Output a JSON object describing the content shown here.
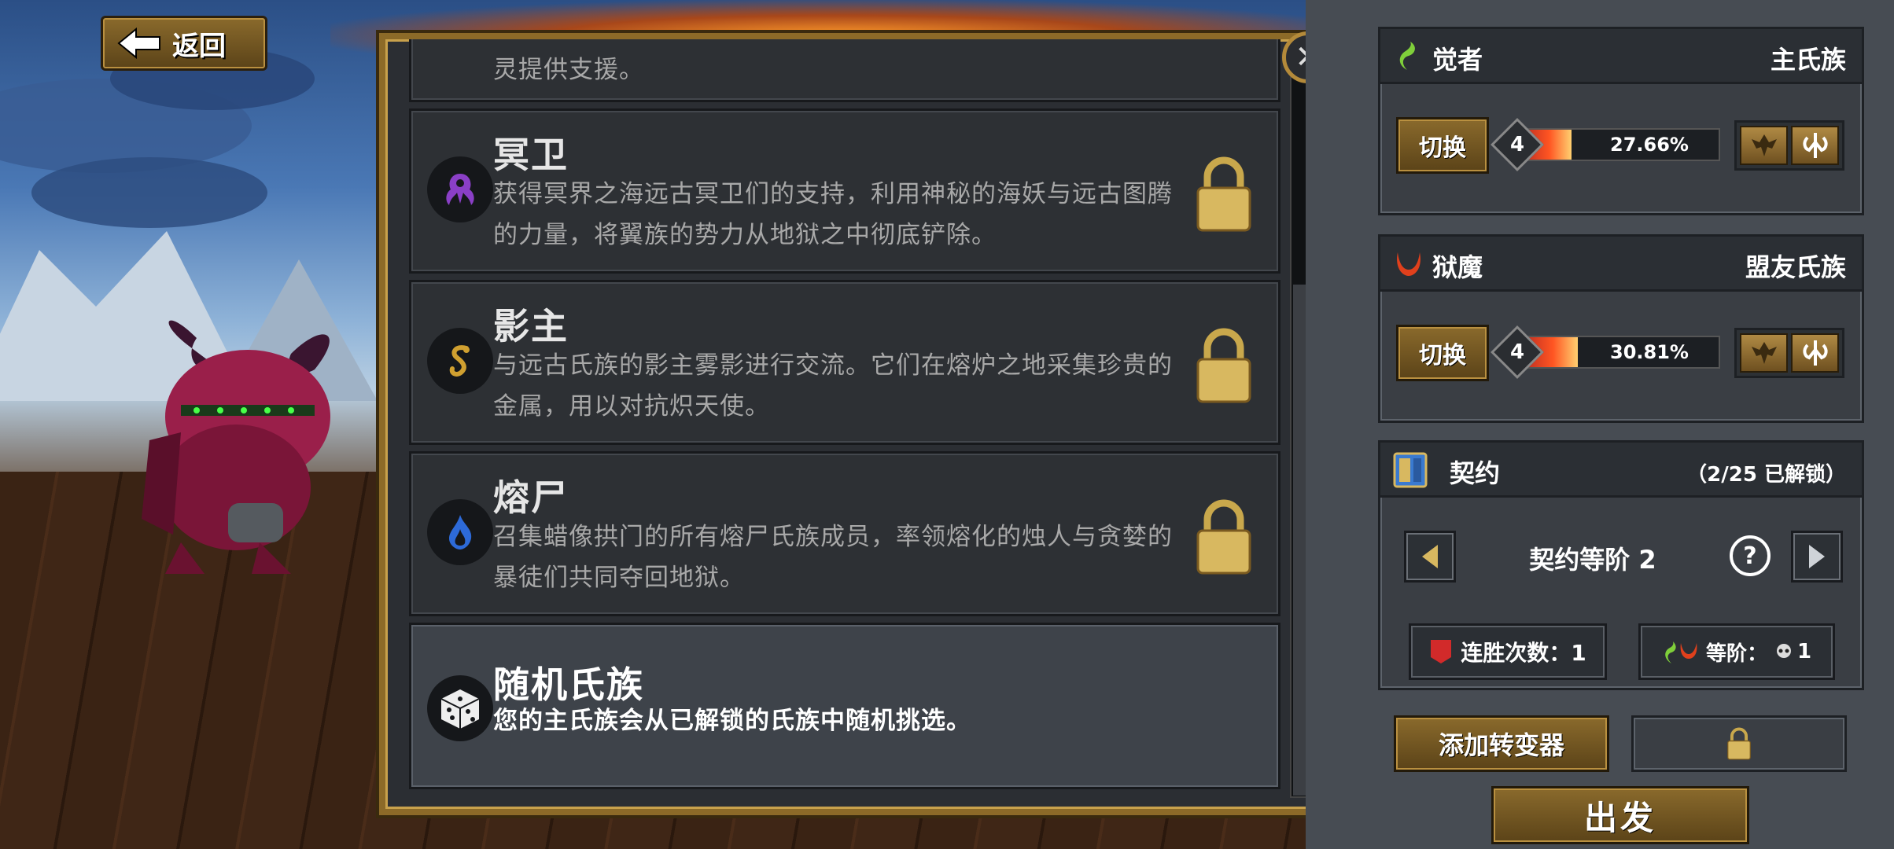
{
  "nav": {
    "back_label": "返回"
  },
  "clans": [
    {
      "name": "",
      "desc": "灵提供支援。",
      "locked": false
    },
    {
      "name": "冥卫",
      "desc": "获得冥界之海远古冥卫们的支持，利用神秘的海妖与远古图腾的力量，将翼族的势力从地狱之中彻底铲除。",
      "icon": "tentacle-icon",
      "locked": true
    },
    {
      "name": "影主",
      "desc": "与远古氏族的影主雾影进行交流。它们在熔炉之地采集珍贵的金属，用以对抗炽天使。",
      "icon": "spiral-icon",
      "locked": true
    },
    {
      "name": "熔尸",
      "desc": "召集蜡像拱门的所有熔尸氏族成员，率领熔化的烛人与贪婪的暴徒们共同夺回地狱。",
      "icon": "flame-icon",
      "locked": true
    },
    {
      "name": "随机氏族",
      "desc": "您的主氏族会从已解锁的氏族中随机挑选。",
      "icon": "dice-icon",
      "locked": false
    }
  ],
  "primary_clan": {
    "name": "觉者",
    "role": "主氏族",
    "switch_label": "切换",
    "level": "4",
    "progress_text": "27.66%",
    "progress": 0.2766,
    "color": "#7fcf3a"
  },
  "allied_clan": {
    "name": "狱魔",
    "role": "盟友氏族",
    "switch_label": "切换",
    "level": "4",
    "progress_text": "30.81%",
    "progress": 0.3081,
    "color": "#e0401c"
  },
  "covenant": {
    "title": "契约",
    "unlocked": "（2/25 已解锁）",
    "rank_label": "契约等阶 2",
    "win_streak": "连胜次数：1",
    "grade": "等阶：",
    "grade_value": "1"
  },
  "actions": {
    "add_mutator": "添加转变器",
    "embark": "出发"
  }
}
